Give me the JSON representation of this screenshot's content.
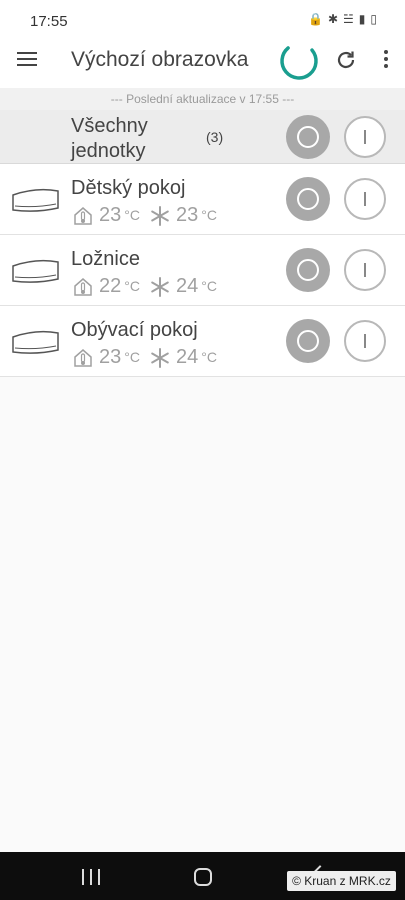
{
  "status_bar": {
    "time": "17:55",
    "icons": [
      "lock-icon",
      "bluetooth-icon",
      "wifi-icon",
      "signal-icon",
      "battery-icon"
    ]
  },
  "app_bar": {
    "title": "Výchozí obrazovka",
    "icons": [
      "menu-icon",
      "loading-spinner",
      "refresh-icon",
      "more-vert-icon"
    ],
    "accent_color": "#1a9e8f"
  },
  "update_line": "--- Poslední aktualizace v 17:55 ---",
  "all_units": {
    "title": "Všechny jednotky",
    "count": "(3)"
  },
  "units": [
    {
      "name": "Dětský pokoj",
      "indoor_temp": "23",
      "target_temp": "23",
      "unit": "°C"
    },
    {
      "name": "Ložnice",
      "indoor_temp": "22",
      "target_temp": "24",
      "unit": "°C"
    },
    {
      "name": "Obývací pokoj",
      "indoor_temp": "23",
      "target_temp": "24",
      "unit": "°C"
    }
  ],
  "watermark": "© Kruan z MRK.cz"
}
